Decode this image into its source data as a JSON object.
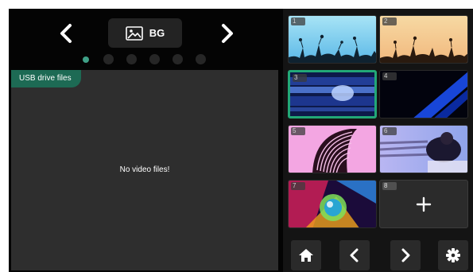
{
  "header": {
    "mode_label": "BG",
    "mode_icon": "image-icon"
  },
  "pager": {
    "page_count": 6,
    "active_index": 0
  },
  "files": {
    "tab_label": "USB drive files",
    "empty_message": "No video files!"
  },
  "thumbnails": [
    {
      "number": "1",
      "content": "plant silhouettes against blue sky"
    },
    {
      "number": "2",
      "content": "plant silhouettes against peach sunset"
    },
    {
      "number": "3",
      "content": "blue abstract light streaks",
      "selected": true
    },
    {
      "number": "4",
      "content": "dark blue diagonal light"
    },
    {
      "number": "5",
      "content": "curved building on pink sky"
    },
    {
      "number": "6",
      "content": "person in motion blur"
    },
    {
      "number": "7",
      "content": "colorful glass sphere"
    },
    {
      "number": "8",
      "content": "empty slot",
      "empty": true
    }
  ],
  "colors": {
    "accent": "#22a877",
    "tab": "#1d6a54",
    "panel": "#2e2e2e",
    "background": "#040404"
  },
  "toolbar": [
    "home-icon",
    "chevron-left-icon",
    "chevron-right-icon",
    "gear-icon"
  ]
}
